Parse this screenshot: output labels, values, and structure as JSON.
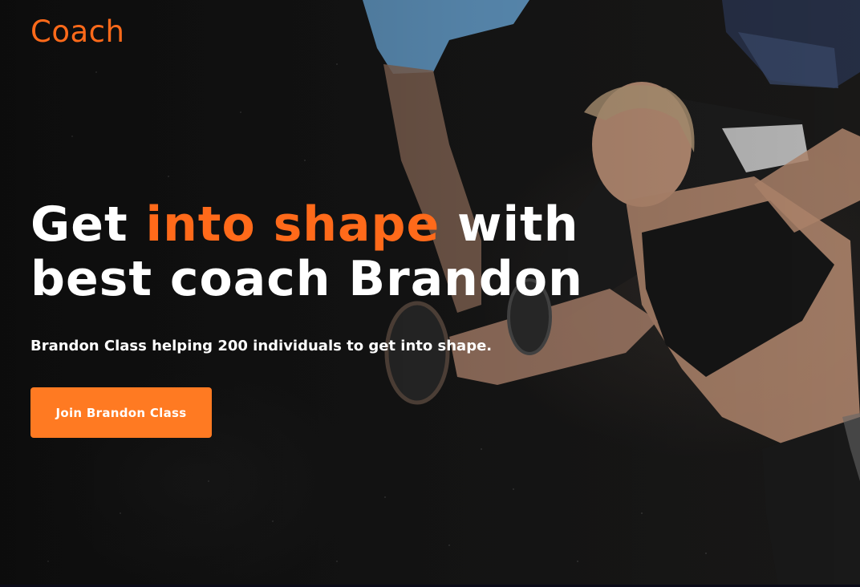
{
  "brand": {
    "logo_text": "Coach",
    "accent_color": "#ff6a1a"
  },
  "hero": {
    "headline_part1": "Get ",
    "headline_accent": "into shape",
    "headline_part2": " with best coach Brandon",
    "subtext": "Brandon Class helping 200 individuals to get into shape.",
    "cta_label": "Join Brandon Class",
    "background_image": "woman-bench-press-dumbbells-with-trainer"
  }
}
